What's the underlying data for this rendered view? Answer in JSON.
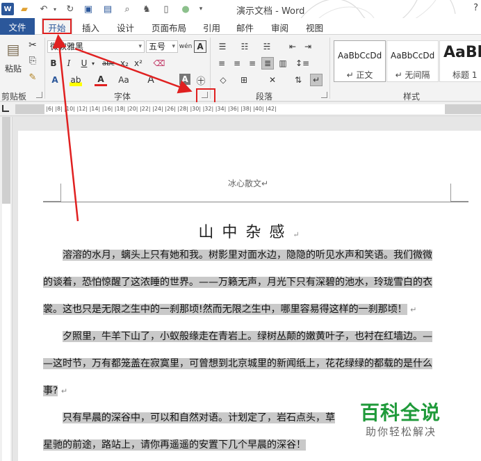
{
  "titlebar": {
    "logo": "W",
    "title": "演示文档 - Word",
    "help": "?"
  },
  "tabs": {
    "file": "文件",
    "home": "开始",
    "insert": "插入",
    "design": "设计",
    "layout": "页面布局",
    "references": "引用",
    "mailings": "邮件",
    "review": "审阅",
    "view": "视图"
  },
  "ribbon": {
    "clipboard": {
      "label": "剪贴板",
      "paste": "粘贴"
    },
    "font": {
      "label": "字体",
      "font_name": "微软雅黑",
      "font_size": "五号",
      "bold": "B",
      "italic": "I",
      "underline": "U",
      "strike": "abc",
      "subscript": "x₂",
      "superscript": "x²",
      "change_case": "Aa",
      "grow": "A",
      "char_border": "A"
    },
    "paragraph": {
      "label": "段落"
    },
    "styles": {
      "label": "样式",
      "items": [
        {
          "sample": "AaBbCcDd",
          "name": "↵ 正文"
        },
        {
          "sample": "AaBbCcDd",
          "name": "↵ 无间隔"
        },
        {
          "sample": "AaBl",
          "name": "标题 1"
        }
      ]
    }
  },
  "ruler": {
    "marks": "|2|  |  |2|  |4|  |6|  |8|  |10|  |12|  |14|  |16|  |18|  |20|  |22|  |24|  |26|  |28|  |30|  |32|  |34|  |36|  |38|  |40|  |42|"
  },
  "document": {
    "header": "冰心散文↵",
    "title": "山中杂感",
    "title_mark": "↵",
    "paragraphs": [
      {
        "lines": [
          "溶溶的水月，螭头上只有她和我。树影里对面水边，隐隐的听见水声和笑语。我们微微",
          "的谈着，恐怕惊醒了这浓睡的世界。——万籁无声，月光下只有深碧的池水，玲珑雪白的衣",
          "裳。这也只是无限之生中的一刹那顷!然而无限之生中，哪里容易得这样的一刹那顷！"
        ]
      },
      {
        "lines": [
          "夕照里，牛羊下山了，小蚁般缘走在青岩上。绿树丛颠的嫩黄叶子，也衬在红墙边。—",
          "—这时节，万有都笼盖在寂寞里，可曾想到北京城里的新闻纸上，花花绿绿的都载的是什么",
          "事?"
        ]
      },
      {
        "lines": [
          "只有早晨的深谷中，可以和自然对语。计划定了，岩石点头，草",
          "星驰的前途，路站上，请你再遥遥的安置下几个早晨的深谷！"
        ]
      }
    ]
  },
  "watermark": {
    "title": "百科全说",
    "subtitle": "助你轻松解决"
  },
  "colors": {
    "brand": "#2b579a",
    "annotation": "#e02020",
    "highlight": "#c9c9c9",
    "watermark": "#1f9a3a"
  }
}
